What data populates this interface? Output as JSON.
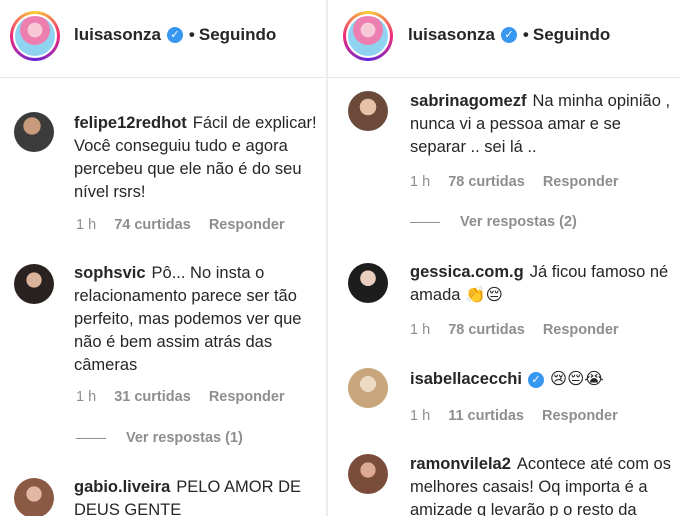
{
  "left": {
    "header": {
      "username": "luisasonza",
      "separator": "•",
      "follow_status": "Seguindo"
    },
    "comments": [
      {
        "username": "felipe12redhot",
        "text": "Fácil de explicar! Você conseguiu tudo e agora percebeu que ele não é do seu nível rsrs!",
        "time": "1 h",
        "likes": "74 curtidas",
        "reply": "Responder"
      },
      {
        "username": "sophsvic",
        "text": "Pô... No insta o relacionamento parece ser tão perfeito, mas podemos ver que não é bem assim atrás das câmeras",
        "time": "1 h",
        "likes": "31 curtidas",
        "reply": "Responder",
        "view_replies": "Ver respostas (1)"
      },
      {
        "username": "gabio.liveira",
        "text": "PELO AMOR DE DEUS GENTE"
      }
    ]
  },
  "right": {
    "header": {
      "username": "luisasonza",
      "separator": "•",
      "follow_status": "Seguindo"
    },
    "comments": [
      {
        "username": "sabrinagomezf",
        "text": "Na minha opinião , nunca vi a pessoa amar e se separar .. sei lá ..",
        "time": "1 h",
        "likes": "78 curtidas",
        "reply": "Responder",
        "view_replies": "Ver respostas (2)"
      },
      {
        "username": "gessica.com.g",
        "text": "Já ficou famoso né amada 👏😔",
        "time": "1 h",
        "likes": "78 curtidas",
        "reply": "Responder"
      },
      {
        "username": "isabellacecchi",
        "text": "😢😔😭",
        "time": "1 h",
        "likes": "11 curtidas",
        "reply": "Responder"
      },
      {
        "username": "ramonvilela2",
        "text": "Acontece até com os melhores casais! Oq importa é a amizade q levarão p o resto da"
      }
    ]
  },
  "icons": {
    "verified": "verified-badge-icon"
  }
}
